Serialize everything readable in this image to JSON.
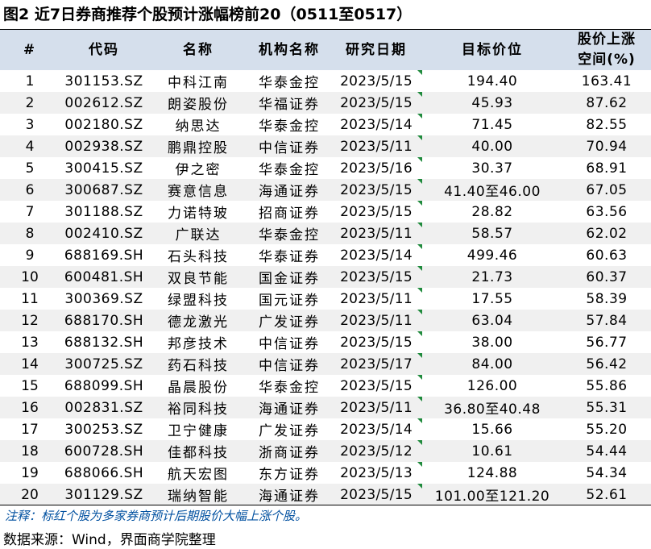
{
  "title": "图2  近7日券商推荐个股预计涨幅榜前20（0511至0517）",
  "headers": {
    "rank": "#",
    "code": "代码",
    "name": "名称",
    "institution": "机构名称",
    "date": "研究日期",
    "target": "目标价位",
    "upside_line1": "股价上涨",
    "upside_line2": "空间(%)"
  },
  "rows": [
    {
      "rank": "1",
      "code": "301153.SZ",
      "name": "中科江南",
      "institution": "华泰金控",
      "date": "2023/5/15",
      "target": "194.40",
      "upside": "163.41"
    },
    {
      "rank": "2",
      "code": "002612.SZ",
      "name": "朗姿股份",
      "institution": "华福证券",
      "date": "2023/5/15",
      "target": "45.93",
      "upside": "87.62"
    },
    {
      "rank": "3",
      "code": "002180.SZ",
      "name": "纳思达",
      "institution": "华泰金控",
      "date": "2023/5/14",
      "target": "71.45",
      "upside": "82.55"
    },
    {
      "rank": "4",
      "code": "002938.SZ",
      "name": "鹏鼎控股",
      "institution": "中信证券",
      "date": "2023/5/11",
      "target": "40.00",
      "upside": "70.94"
    },
    {
      "rank": "5",
      "code": "300415.SZ",
      "name": "伊之密",
      "institution": "华泰金控",
      "date": "2023/5/16",
      "target": "30.37",
      "upside": "68.91"
    },
    {
      "rank": "6",
      "code": "300687.SZ",
      "name": "赛意信息",
      "institution": "海通证券",
      "date": "2023/5/15",
      "target": "41.40至46.00",
      "upside": "67.05"
    },
    {
      "rank": "7",
      "code": "301188.SZ",
      "name": "力诺特玻",
      "institution": "招商证券",
      "date": "2023/5/15",
      "target": "28.82",
      "upside": "63.56"
    },
    {
      "rank": "8",
      "code": "002410.SZ",
      "name": "广联达",
      "institution": "华泰金控",
      "date": "2023/5/11",
      "target": "58.57",
      "upside": "62.02"
    },
    {
      "rank": "9",
      "code": "688169.SH",
      "name": "石头科技",
      "institution": "华泰证券",
      "date": "2023/5/14",
      "target": "499.46",
      "upside": "60.63"
    },
    {
      "rank": "10",
      "code": "600481.SH",
      "name": "双良节能",
      "institution": "国金证券",
      "date": "2023/5/15",
      "target": "21.73",
      "upside": "60.37"
    },
    {
      "rank": "11",
      "code": "300369.SZ",
      "name": "绿盟科技",
      "institution": "国元证券",
      "date": "2023/5/11",
      "target": "17.55",
      "upside": "58.39"
    },
    {
      "rank": "12",
      "code": "688170.SH",
      "name": "德龙激光",
      "institution": "广发证券",
      "date": "2023/5/11",
      "target": "63.04",
      "upside": "57.84"
    },
    {
      "rank": "13",
      "code": "688132.SH",
      "name": "邦彦技术",
      "institution": "中信证券",
      "date": "2023/5/15",
      "target": "38.00",
      "upside": "56.77"
    },
    {
      "rank": "14",
      "code": "300725.SZ",
      "name": "药石科技",
      "institution": "中信证券",
      "date": "2023/5/17",
      "target": "84.00",
      "upside": "56.42"
    },
    {
      "rank": "15",
      "code": "688099.SH",
      "name": "晶晨股份",
      "institution": "华泰金控",
      "date": "2023/5/15",
      "target": "126.00",
      "upside": "55.86"
    },
    {
      "rank": "16",
      "code": "002831.SZ",
      "name": "裕同科技",
      "institution": "海通证券",
      "date": "2023/5/11",
      "target": "36.80至40.48",
      "upside": "55.31"
    },
    {
      "rank": "17",
      "code": "300253.SZ",
      "name": "卫宁健康",
      "institution": "广发证券",
      "date": "2023/5/14",
      "target": "15.66",
      "upside": "55.20"
    },
    {
      "rank": "18",
      "code": "600728.SH",
      "name": "佳都科技",
      "institution": "浙商证券",
      "date": "2023/5/12",
      "target": "10.61",
      "upside": "54.44"
    },
    {
      "rank": "19",
      "code": "688066.SH",
      "name": "航天宏图",
      "institution": "东方证券",
      "date": "2023/5/13",
      "target": "124.88",
      "upside": "54.34"
    },
    {
      "rank": "20",
      "code": "301129.SZ",
      "name": "瑞纳智能",
      "institution": "海通证券",
      "date": "2023/5/15",
      "target": "101.00至121.20",
      "upside": "52.61"
    }
  ],
  "note": "注释：标红个股为多家券商预计后期股价大幅上涨个股。",
  "source": "数据来源：Wind，界面商学院整理",
  "colors": {
    "header_bg": "#d5dfec",
    "stripe_bg": "#f0f0f0",
    "note_text": "#0050a0",
    "date_marker": "#1f8a3c"
  }
}
